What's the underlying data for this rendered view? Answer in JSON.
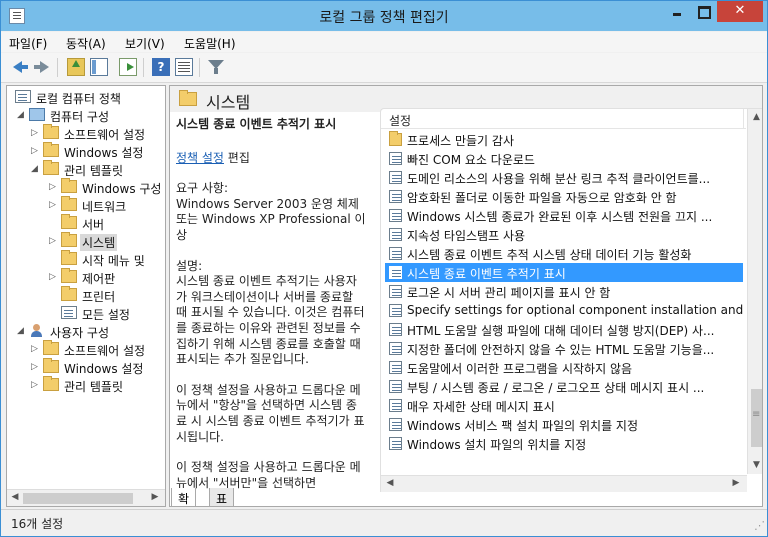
{
  "window": {
    "title": "로컬 그룹 정책 편집기"
  },
  "menu": [
    "파일(F)",
    "동작(A)",
    "보기(V)",
    "도움말(H)"
  ],
  "toolbar": {
    "help_glyph": "?"
  },
  "tree": [
    {
      "label": "로컬 컴퓨터 정책",
      "icon": "policy-icon",
      "level": 0,
      "expander": ""
    },
    {
      "label": "컴퓨터 구성",
      "icon": "computer-icon",
      "level": 1,
      "expander": "open"
    },
    {
      "label": "소프트웨어 설정",
      "icon": "folder-icon",
      "level": 2,
      "expander": "closed"
    },
    {
      "label": "Windows 설정",
      "icon": "folder-icon",
      "level": 2,
      "expander": "closed"
    },
    {
      "label": "관리 템플릿",
      "icon": "folder-icon",
      "level": 2,
      "expander": "open"
    },
    {
      "label": "Windows 구성",
      "icon": "folder-icon",
      "level": 3,
      "expander": "closed"
    },
    {
      "label": "네트워크",
      "icon": "folder-icon",
      "level": 3,
      "expander": "closed"
    },
    {
      "label": "서버",
      "icon": "folder-icon",
      "level": 3,
      "expander": ""
    },
    {
      "label": "시스템",
      "icon": "folder-icon",
      "level": 3,
      "expander": "closed",
      "selected": true
    },
    {
      "label": "시작 메뉴 및",
      "icon": "folder-icon",
      "level": 3,
      "expander": ""
    },
    {
      "label": "제어판",
      "icon": "folder-icon",
      "level": 3,
      "expander": "closed"
    },
    {
      "label": "프린터",
      "icon": "folder-icon",
      "level": 3,
      "expander": ""
    },
    {
      "label": "모든 설정",
      "icon": "policy-icon",
      "level": 3,
      "expander": ""
    },
    {
      "label": "사용자 구성",
      "icon": "user-icon",
      "level": 1,
      "expander": "open"
    },
    {
      "label": "소프트웨어 설정",
      "icon": "folder-icon",
      "level": 2,
      "expander": "closed"
    },
    {
      "label": "Windows 설정",
      "icon": "folder-icon",
      "level": 2,
      "expander": "closed"
    },
    {
      "label": "관리 템플릿",
      "icon": "folder-icon",
      "level": 2,
      "expander": "closed"
    }
  ],
  "right_header": {
    "title": "시스템"
  },
  "description": {
    "title": "시스템 종료 이벤트 추적기 표시",
    "link": "정책 설정",
    "link_suffix": " 편집",
    "requirements": "요구 사항:\nWindows Server 2003 운영 체제 또는 Windows XP Professional 이상",
    "desc_heading": "설명:",
    "desc_body": "시스템 종료 이벤트 추적기는 사용자가 워크스테이션이나 서버를 종료할 때 표시될 수 있습니다.  이것은 컴퓨터를 종료하는 이유와 관련된 정보를 수집하기 위해 시스템 종료를 호출할 때 표시되는 추가 질문입니다.",
    "para2": "이 정책 설정을 사용하고 드롭다운 메뉴에서 \"항상\"을 선택하면 시스템 종료 시 시스템 종료 이벤트 추적기가 표시됩니다.",
    "para3": "이 정책 설정을 사용하고 드롭다운 메뉴에서 \"서버만\"을 선택하면"
  },
  "list": {
    "column": "설정",
    "rows": [
      {
        "label": "프로세스 만들기 감사",
        "icon": "folder-icon"
      },
      {
        "label": "빠진 COM 요소 다운로드",
        "icon": "setting-icon"
      },
      {
        "label": "도메인 리소스의 사용을 위해 분산 링크 추적 클라이언트를...",
        "icon": "setting-icon"
      },
      {
        "label": "암호화된 폴더로 이동한 파일을 자동으로 암호화 안 함",
        "icon": "setting-icon"
      },
      {
        "label": "Windows 시스템 종료가 완료된 이후 시스템 전원을 끄지 ...",
        "icon": "setting-icon"
      },
      {
        "label": "지속성 타임스탬프 사용",
        "icon": "setting-icon"
      },
      {
        "label": "시스템 종료 이벤트 추적 시스템 상태 데이터 기능 활성화",
        "icon": "setting-icon"
      },
      {
        "label": "시스템 종료 이벤트 추적기 표시",
        "icon": "setting-icon",
        "selected": true
      },
      {
        "label": "로그온 시 서버 관리 페이지를 표시 안 함",
        "icon": "setting-icon"
      },
      {
        "label": "Specify settings for optional component installation and c...",
        "icon": "setting-icon"
      },
      {
        "label": "HTML 도움말 실행 파일에 대해 데이터 실행 방지(DEP) 사...",
        "icon": "setting-icon"
      },
      {
        "label": "지정한 폴더에 안전하지 않을 수 있는 HTML 도움말 기능을...",
        "icon": "setting-icon"
      },
      {
        "label": "도움말에서 이러한 프로그램을 시작하지 않음",
        "icon": "setting-icon"
      },
      {
        "label": "부팅 / 시스템 종료 / 로그온 / 로그오프 상태 메시지 표시 ...",
        "icon": "setting-icon"
      },
      {
        "label": "매우 자세한 상태 메시지 표시",
        "icon": "setting-icon"
      },
      {
        "label": "Windows 서비스 팩 설치 파일의 위치를 지정",
        "icon": "setting-icon"
      },
      {
        "label": "Windows 설치 파일의 위치를 지정",
        "icon": "setting-icon"
      }
    ]
  },
  "tabs": [
    {
      "label": "확장",
      "active": true
    },
    {
      "label": "표준",
      "active": false
    }
  ],
  "status": {
    "text": "16개 설정"
  },
  "colors": {
    "titlebar": "#77bde9",
    "close": "#c7443a",
    "selection": "#3399ff",
    "link": "#1a5fb4"
  }
}
